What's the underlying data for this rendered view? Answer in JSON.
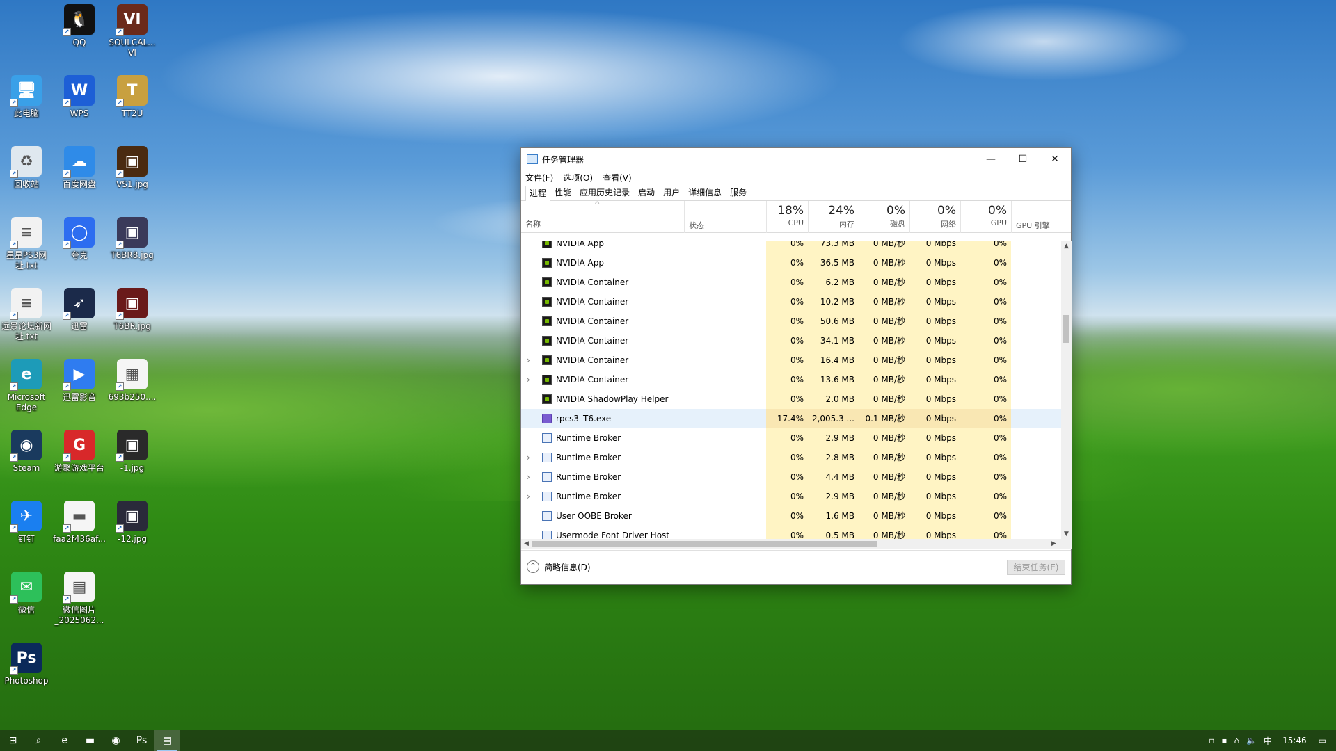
{
  "desktop": {
    "icons": [
      {
        "label": "QQ",
        "color": "#111111",
        "glyph": "🐧"
      },
      {
        "label": "SOULCAL...\nVI",
        "color": "#6b2a1a",
        "glyph": "VI"
      },
      {
        "label": "此电脑",
        "color": "#3aa0e8",
        "glyph": "🖥"
      },
      {
        "label": "WPS",
        "color": "#1d5fd6",
        "glyph": "W"
      },
      {
        "label": "TT2U",
        "color": "#c8a040",
        "glyph": "T"
      },
      {
        "label": "回收站",
        "color": "#dfe8ef",
        "glyph": "♻"
      },
      {
        "label": "百度网盘",
        "color": "#2f8be8",
        "glyph": "☁"
      },
      {
        "label": "VS1.jpg",
        "color": "#4a2a10",
        "glyph": "▣"
      },
      {
        "label": "星星PS3网\n址.txt",
        "color": "#f2f2f2",
        "glyph": "≡"
      },
      {
        "label": "夸克",
        "color": "#2d6df0",
        "glyph": "◯"
      },
      {
        "label": "T6BR8.jpg",
        "color": "#3a3a5a",
        "glyph": "▣"
      },
      {
        "label": "远景论坛新网\n址.txt",
        "color": "#f2f2f2",
        "glyph": "≡"
      },
      {
        "label": "迅雷",
        "color": "#1b2a4a",
        "glyph": "➶"
      },
      {
        "label": "T6BR.jpg",
        "color": "#6a1a1a",
        "glyph": "▣"
      },
      {
        "label": "Microsoft\nEdge",
        "color": "#1d9bb8",
        "glyph": "e"
      },
      {
        "label": "迅雷影音",
        "color": "#2f7cf0",
        "glyph": "▶"
      },
      {
        "label": "693b250....",
        "color": "#f5f5f5",
        "glyph": "▦"
      },
      {
        "label": "Steam",
        "color": "#1a3a5e",
        "glyph": "◉"
      },
      {
        "label": "游聚游戏平台",
        "color": "#d8282a",
        "glyph": "G"
      },
      {
        "label": "-1.jpg",
        "color": "#2a2a2a",
        "glyph": "▣"
      },
      {
        "label": "钉钉",
        "color": "#1a7ff0",
        "glyph": "✈"
      },
      {
        "label": "faa2f436af...",
        "color": "#f5f5f5",
        "glyph": "▬"
      },
      {
        "label": "-12.jpg",
        "color": "#2a2a3a",
        "glyph": "▣"
      },
      {
        "label": "微信",
        "color": "#2dc05a",
        "glyph": "✉"
      },
      {
        "label": "微信图片\n_2025062...",
        "color": "#f5f5f5",
        "glyph": "▤"
      },
      {
        "label": "Photoshop",
        "color": "#0b2a5a",
        "glyph": "Ps"
      }
    ]
  },
  "task_manager": {
    "title": "任务管理器",
    "window_buttons": {
      "minimize": "—",
      "maximize": "☐",
      "close": "✕"
    },
    "menu": [
      "文件(F)",
      "选项(O)",
      "查看(V)"
    ],
    "tabs": [
      "进程",
      "性能",
      "应用历史记录",
      "启动",
      "用户",
      "详细信息",
      "服务"
    ],
    "active_tab": "进程",
    "header": {
      "name_label": "名称",
      "status_label": "状态",
      "cpu": {
        "pct": "18%",
        "label": "CPU"
      },
      "mem": {
        "pct": "24%",
        "label": "内存"
      },
      "disk": {
        "pct": "0%",
        "label": "磁盘"
      },
      "net": {
        "pct": "0%",
        "label": "网络"
      },
      "gpu": {
        "pct": "0%",
        "label": "GPU"
      },
      "gpu_engine": {
        "label": "GPU 引擎"
      }
    },
    "rows": [
      {
        "name": "NVIDIA App",
        "icon": "nvidia",
        "expand": false,
        "cpu": "0%",
        "mem": "73.3 MB",
        "disk": "0 MB/秒",
        "net": "0 Mbps",
        "gpu": "0%"
      },
      {
        "name": "NVIDIA App",
        "icon": "nvidia",
        "expand": false,
        "cpu": "0%",
        "mem": "36.5 MB",
        "disk": "0 MB/秒",
        "net": "0 Mbps",
        "gpu": "0%"
      },
      {
        "name": "NVIDIA Container",
        "icon": "nvidia",
        "expand": false,
        "cpu": "0%",
        "mem": "6.2 MB",
        "disk": "0 MB/秒",
        "net": "0 Mbps",
        "gpu": "0%"
      },
      {
        "name": "NVIDIA Container",
        "icon": "nvidia",
        "expand": false,
        "cpu": "0%",
        "mem": "10.2 MB",
        "disk": "0 MB/秒",
        "net": "0 Mbps",
        "gpu": "0%"
      },
      {
        "name": "NVIDIA Container",
        "icon": "nvidia",
        "expand": false,
        "cpu": "0%",
        "mem": "50.6 MB",
        "disk": "0 MB/秒",
        "net": "0 Mbps",
        "gpu": "0%"
      },
      {
        "name": "NVIDIA Container",
        "icon": "nvidia",
        "expand": false,
        "cpu": "0%",
        "mem": "34.1 MB",
        "disk": "0 MB/秒",
        "net": "0 Mbps",
        "gpu": "0%"
      },
      {
        "name": "NVIDIA Container",
        "icon": "nvidia",
        "expand": true,
        "cpu": "0%",
        "mem": "16.4 MB",
        "disk": "0 MB/秒",
        "net": "0 Mbps",
        "gpu": "0%"
      },
      {
        "name": "NVIDIA Container",
        "icon": "nvidia",
        "expand": true,
        "cpu": "0%",
        "mem": "13.6 MB",
        "disk": "0 MB/秒",
        "net": "0 Mbps",
        "gpu": "0%"
      },
      {
        "name": "NVIDIA ShadowPlay Helper",
        "icon": "nvidia",
        "expand": false,
        "cpu": "0%",
        "mem": "2.0 MB",
        "disk": "0 MB/秒",
        "net": "0 Mbps",
        "gpu": "0%"
      },
      {
        "name": "rpcs3_T6.exe",
        "icon": "rpcs3",
        "expand": false,
        "highlight": true,
        "cpu": "17.4%",
        "mem": "2,005.3 ...",
        "disk": "0.1 MB/秒",
        "net": "0 Mbps",
        "gpu": "0%"
      },
      {
        "name": "Runtime Broker",
        "icon": "broker",
        "expand": false,
        "cpu": "0%",
        "mem": "2.9 MB",
        "disk": "0 MB/秒",
        "net": "0 Mbps",
        "gpu": "0%"
      },
      {
        "name": "Runtime Broker",
        "icon": "broker",
        "expand": true,
        "cpu": "0%",
        "mem": "2.8 MB",
        "disk": "0 MB/秒",
        "net": "0 Mbps",
        "gpu": "0%"
      },
      {
        "name": "Runtime Broker",
        "icon": "broker",
        "expand": true,
        "cpu": "0%",
        "mem": "4.4 MB",
        "disk": "0 MB/秒",
        "net": "0 Mbps",
        "gpu": "0%"
      },
      {
        "name": "Runtime Broker",
        "icon": "broker",
        "expand": true,
        "cpu": "0%",
        "mem": "2.9 MB",
        "disk": "0 MB/秒",
        "net": "0 Mbps",
        "gpu": "0%"
      },
      {
        "name": "User OOBE Broker",
        "icon": "broker",
        "expand": false,
        "cpu": "0%",
        "mem": "1.6 MB",
        "disk": "0 MB/秒",
        "net": "0 Mbps",
        "gpu": "0%"
      },
      {
        "name": "Usermode Font Driver Host",
        "icon": "broker",
        "expand": false,
        "cpu": "0%",
        "mem": "0.5 MB",
        "disk": "0 MB/秒",
        "net": "0 Mbps",
        "gpu": "0%"
      }
    ],
    "fewer_details": "简略信息(D)",
    "end_task": "结束任务(E)"
  },
  "taskbar": {
    "buttons": [
      {
        "name": "start-button",
        "glyph": "⊞"
      },
      {
        "name": "search-button",
        "glyph": "⌕"
      },
      {
        "name": "edge-taskbar-button",
        "glyph": "e"
      },
      {
        "name": "explorer-taskbar-button",
        "glyph": "▬"
      },
      {
        "name": "app-taskbar-button",
        "glyph": "◉"
      },
      {
        "name": "photoshop-taskbar-button",
        "glyph": "Ps"
      },
      {
        "name": "taskmgr-taskbar-button",
        "glyph": "▤"
      }
    ],
    "tray": {
      "ime": "中",
      "time": "15:46"
    }
  }
}
